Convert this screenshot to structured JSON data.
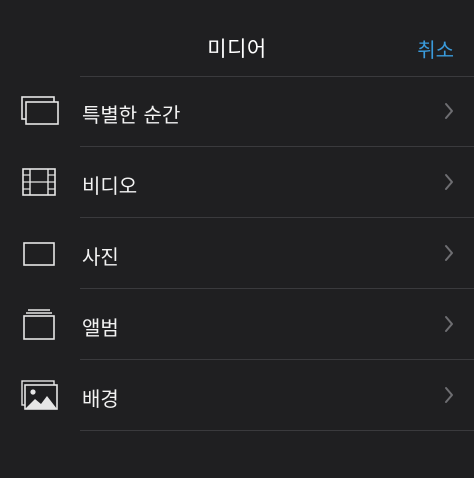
{
  "header": {
    "title": "미디어",
    "cancel_label": "취소"
  },
  "items": [
    {
      "label": "특별한 순간",
      "icon": "stacked-photos-icon"
    },
    {
      "label": "비디오",
      "icon": "film-icon"
    },
    {
      "label": "사진",
      "icon": "photo-frame-icon"
    },
    {
      "label": "앨범",
      "icon": "album-icon"
    },
    {
      "label": "배경",
      "icon": "landscape-image-icon"
    }
  ],
  "colors": {
    "background": "#1f1f21",
    "accent": "#3a9bdc",
    "separator": "#3a3a3d",
    "icon": "#e6e6e6",
    "chevron": "#6e6e72"
  }
}
